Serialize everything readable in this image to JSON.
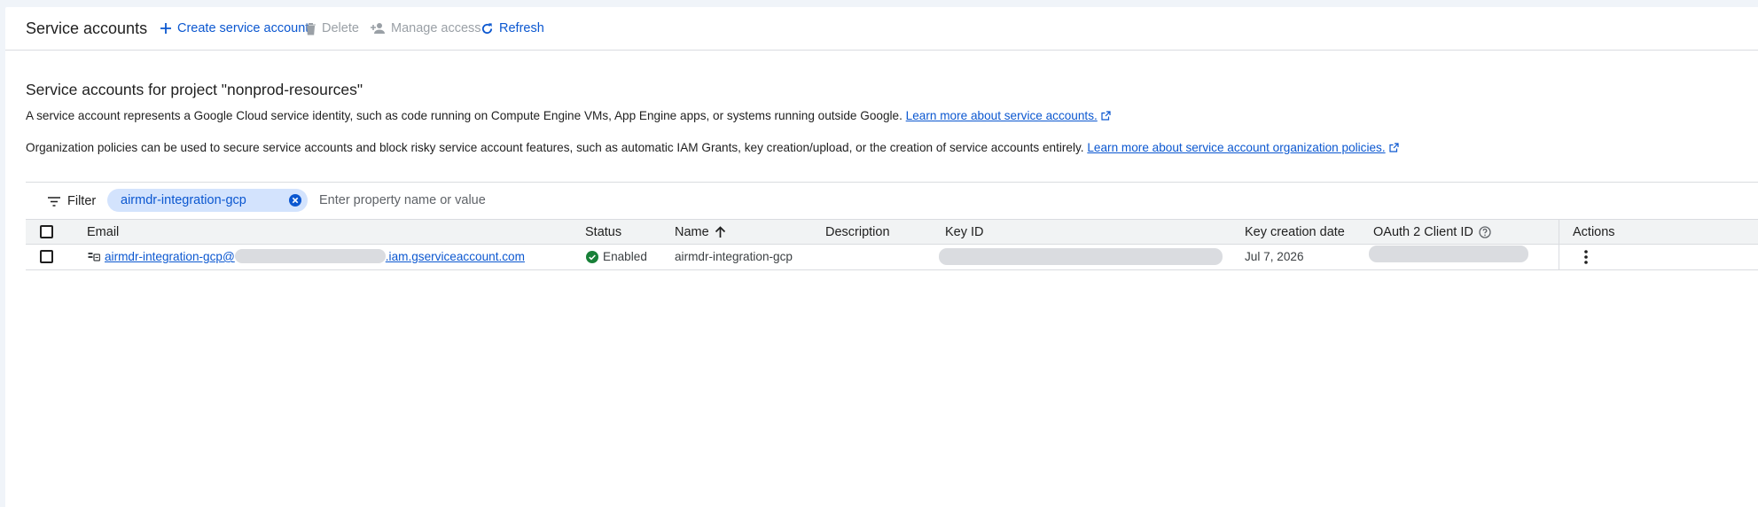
{
  "toolbar": {
    "title": "Service accounts",
    "create_label": "Create service account",
    "delete_label": "Delete",
    "manage_access_label": "Manage access",
    "refresh_label": "Refresh"
  },
  "main": {
    "section_title": "Service accounts for project \"nonprod-resources\"",
    "description": "A service account represents a Google Cloud service identity, such as code running on Compute Engine VMs, App Engine apps, or systems running outside Google.",
    "learn_more_label": "Learn more about service accounts.",
    "policy_text": "Organization policies can be used to secure service accounts and block risky service account features, such as automatic IAM Grants, key creation/upload, or the creation of service accounts entirely.",
    "policy_link_label": "Learn more about service account organization policies."
  },
  "filter": {
    "label": "Filter",
    "chip_value": "airmdr-integration-gcp",
    "placeholder": "Enter property name or value"
  },
  "table": {
    "columns": {
      "email": "Email",
      "status": "Status",
      "name": "Name",
      "description": "Description",
      "key_id": "Key ID",
      "key_creation_date": "Key creation date",
      "oauth_client_id": "OAuth 2 Client ID",
      "actions": "Actions"
    },
    "rows": [
      {
        "email_prefix": "airmdr-integration-gcp@",
        "email_suffix": ".iam.gserviceaccount.com",
        "status": "Enabled",
        "name": "airmdr-integration-gcp",
        "description": "",
        "key_creation_date": "Jul 7, 2026"
      }
    ]
  },
  "colors": {
    "accent": "#0b57d0",
    "chip_bg": "#d3e3fd",
    "status_ok": "#188038",
    "redacted": "#dadce0"
  },
  "icons": {
    "create": "add-icon",
    "delete": "trash-icon",
    "manage_access": "person-add-icon",
    "refresh": "refresh-icon",
    "filter": "filter-lines-icon",
    "chip_close": "close-circle-icon",
    "sort": "arrow-up-icon",
    "help": "help-circle-icon",
    "service_account": "service-account-icon",
    "status": "check-circle-icon",
    "actions": "more-vert-icon",
    "external": "external-link-icon"
  }
}
